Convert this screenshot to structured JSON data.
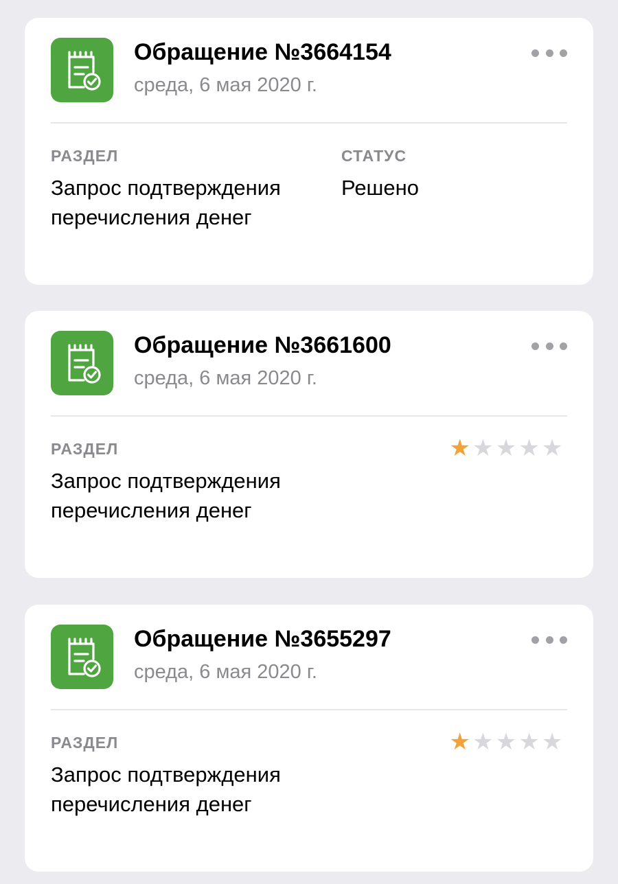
{
  "colors": {
    "background": "#ececf0",
    "card": "#ffffff",
    "icon_bg": "#4fa53f",
    "secondary_text": "#8a8a8e",
    "star_filled": "#f0a33a",
    "star_empty": "#d8d8dc"
  },
  "tickets": [
    {
      "title": "Обращение №3664154",
      "date": "среда, 6 мая 2020 г.",
      "icon": "receipt-check-icon",
      "section_label": "РАЗДЕЛ",
      "section_value": "Запрос подтверждения перечисления денег",
      "status_label": "СТАТУС",
      "status_value": "Решено"
    },
    {
      "title": "Обращение №3661600",
      "date": "среда, 6 мая 2020 г.",
      "icon": "receipt-check-icon",
      "section_label": "РАЗДЕЛ",
      "section_value": "Запрос подтверждения перечисления денег",
      "rating": 1,
      "rating_max": 5
    },
    {
      "title": "Обращение №3655297",
      "date": "среда, 6 мая 2020 г.",
      "icon": "receipt-check-icon",
      "section_label": "РАЗДЕЛ",
      "section_value": "Запрос подтверждения перечисления денег",
      "rating": 1,
      "rating_max": 5
    }
  ]
}
